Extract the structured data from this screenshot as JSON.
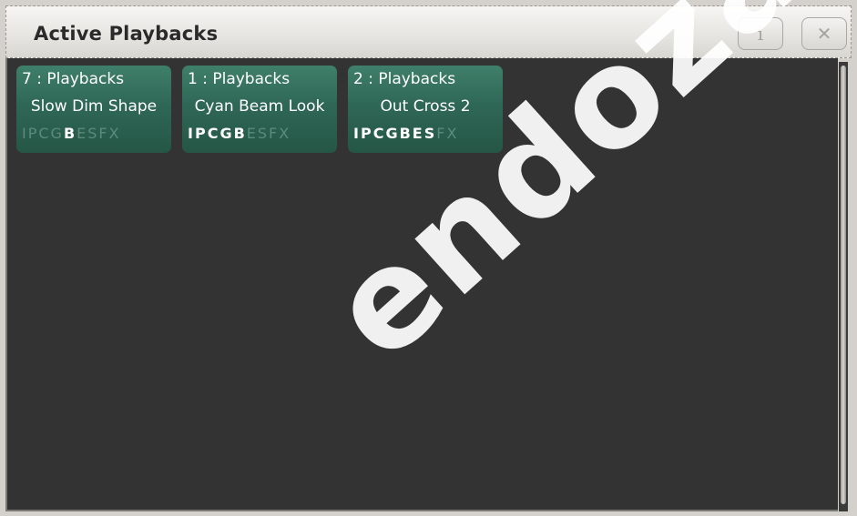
{
  "window": {
    "title": "Active Playbacks",
    "info_label": "i",
    "close_label": "✕"
  },
  "playbacks": [
    {
      "header": "7 : Playbacks",
      "name": "Slow Dim Shape",
      "flags": [
        {
          "t": "I",
          "on": false
        },
        {
          "t": "P",
          "on": false
        },
        {
          "t": "C",
          "on": false
        },
        {
          "t": "G",
          "on": false
        },
        {
          "t": "B",
          "on": true
        },
        {
          "t": "E",
          "on": false
        },
        {
          "t": "S",
          "on": false
        },
        {
          "t": "FX",
          "on": false
        }
      ]
    },
    {
      "header": "1 : Playbacks",
      "name": "Cyan Beam Look",
      "flags": [
        {
          "t": "I",
          "on": true
        },
        {
          "t": "P",
          "on": true
        },
        {
          "t": "C",
          "on": true
        },
        {
          "t": "G",
          "on": true
        },
        {
          "t": "B",
          "on": true
        },
        {
          "t": "E",
          "on": false
        },
        {
          "t": "S",
          "on": false
        },
        {
          "t": "FX",
          "on": false
        }
      ]
    },
    {
      "header": "2 : Playbacks",
      "name": "Out Cross 2",
      "flags": [
        {
          "t": "I",
          "on": true
        },
        {
          "t": "P",
          "on": true
        },
        {
          "t": "C",
          "on": true
        },
        {
          "t": "G",
          "on": true
        },
        {
          "t": "B",
          "on": true
        },
        {
          "t": "E",
          "on": true
        },
        {
          "t": "S",
          "on": true
        },
        {
          "t": "FX",
          "on": false
        }
      ]
    }
  ],
  "watermark": "endoza.co"
}
